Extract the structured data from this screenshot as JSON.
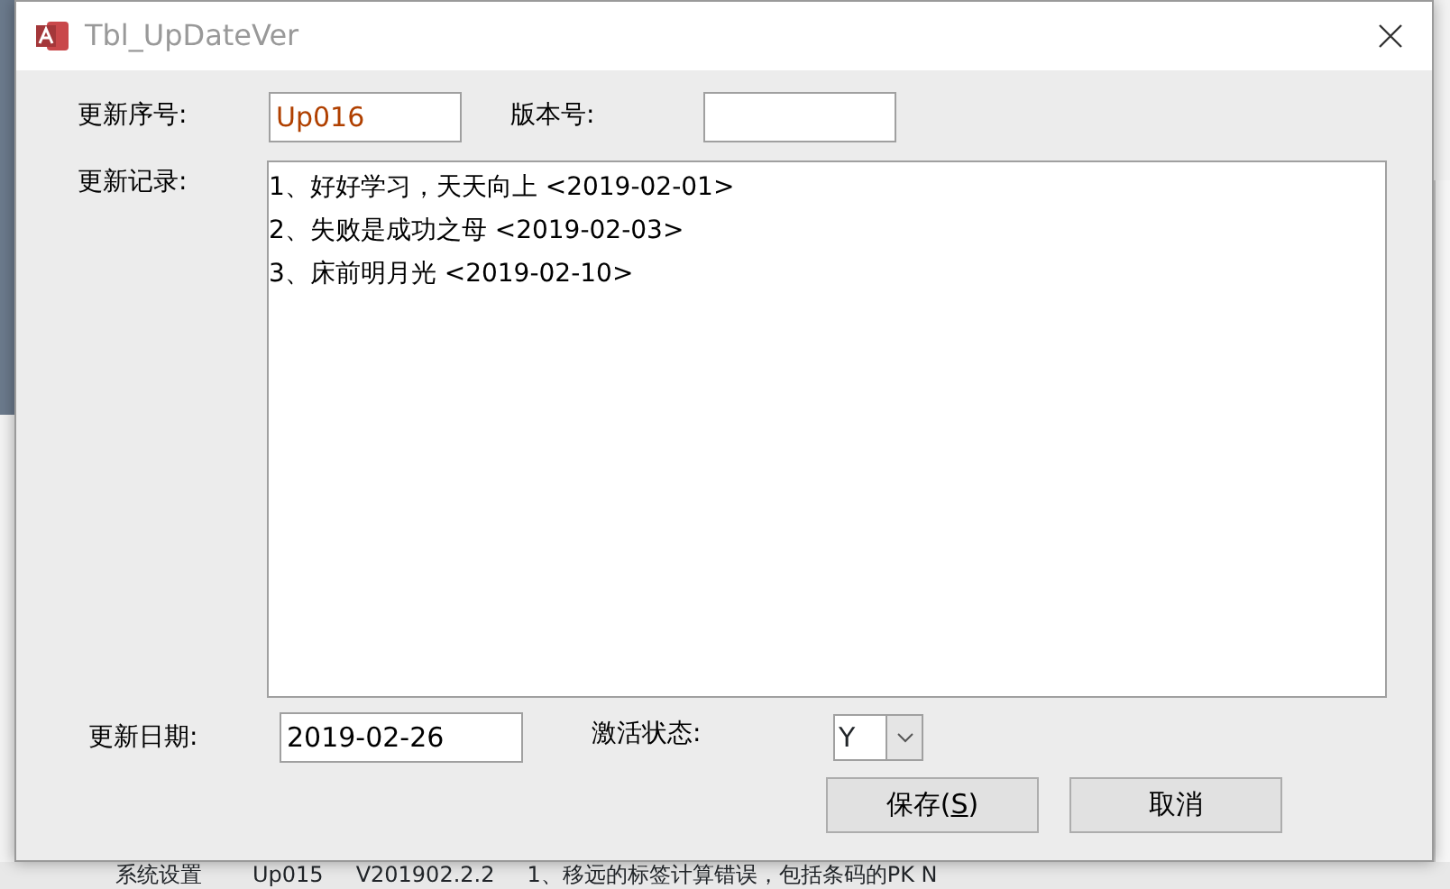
{
  "window": {
    "title": "Tbl_UpDateVer"
  },
  "fields": {
    "update_no": {
      "label": "更新序号:",
      "value": "Up016"
    },
    "version_no": {
      "label": "版本号:"
    },
    "records": {
      "label": "更新记录:",
      "lines": [
        "1、好好学习，天天向上 <2019-02-01>",
        "2、失败是成功之母 <2019-02-03>",
        "3、床前明月光 <2019-02-10>"
      ]
    },
    "update_date": {
      "label": "更新日期:",
      "value": "2019-02-26"
    },
    "active": {
      "label": "激活状态:",
      "value": "Y"
    }
  },
  "buttons": [
    {
      "label": "保存(S)",
      "underline_access_key": true
    },
    {
      "label": "取消"
    }
  ],
  "background_row": [
    "系统设置",
    "Up015",
    "V201902.2.2",
    "1、移远的标签计算错误，包括条码的PK N"
  ]
}
